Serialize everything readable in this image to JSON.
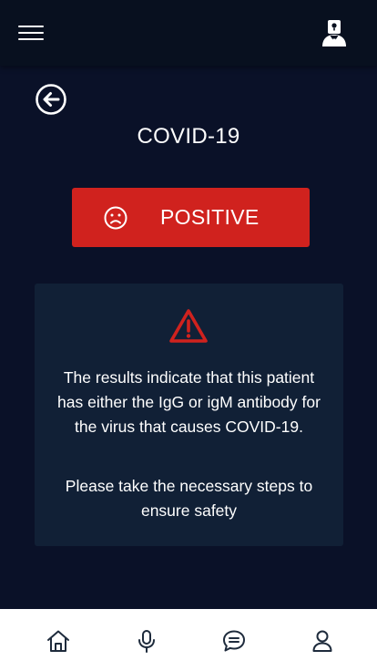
{
  "header": {
    "menu_icon": "hamburger-menu-icon",
    "profile_icon": "doctor-profile-icon"
  },
  "navigation": {
    "back_icon": "arrow-left-circle-icon"
  },
  "test": {
    "title": "COVID-19",
    "result_label": "POSITIVE",
    "result_icon": "sad-face-icon",
    "result_color": "#d0221e"
  },
  "alert": {
    "icon": "warning-triangle-icon",
    "icon_color": "#d0221e",
    "message": "The results indicate that this patient has either the IgG or igM antibody for the virus that causes COVID-19.",
    "instruction": "Please take the necessary steps to ensure safety"
  },
  "bottom_nav": {
    "items": [
      {
        "icon": "home-icon"
      },
      {
        "icon": "microphone-icon"
      },
      {
        "icon": "chat-icon"
      },
      {
        "icon": "user-icon"
      }
    ]
  },
  "colors": {
    "background": "#0a1128",
    "card": "#112036",
    "nav_icon": "#1e2b3c"
  }
}
